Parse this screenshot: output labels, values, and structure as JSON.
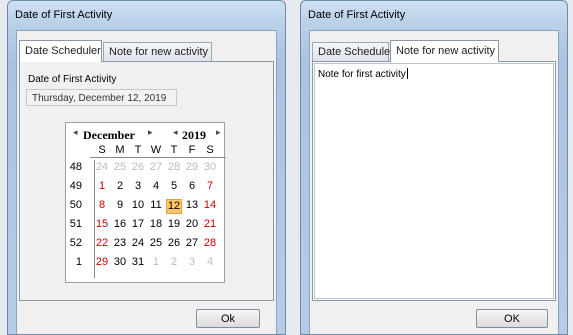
{
  "window1": {
    "title": "Date of First Activity",
    "tabs": [
      "Date Scheduler",
      "Note for new activity"
    ],
    "date_label": "Date of First Activity",
    "date_value": "Thursday, December 12, 2019",
    "ok_label": "Ok",
    "calendar": {
      "month": "December",
      "year": "2019",
      "day_headers": [
        "S",
        "M",
        "T",
        "W",
        "T",
        "F",
        "S"
      ],
      "weeks": [
        {
          "wk": "48",
          "days": [
            "24",
            "25",
            "26",
            "27",
            "28",
            "29",
            "30"
          ]
        },
        {
          "wk": "49",
          "days": [
            "1",
            "2",
            "3",
            "4",
            "5",
            "6",
            "7"
          ]
        },
        {
          "wk": "50",
          "days": [
            "8",
            "9",
            "10",
            "11",
            "12",
            "13",
            "14"
          ]
        },
        {
          "wk": "51",
          "days": [
            "15",
            "16",
            "17",
            "18",
            "19",
            "20",
            "21"
          ]
        },
        {
          "wk": "52",
          "days": [
            "22",
            "23",
            "24",
            "25",
            "26",
            "27",
            "28"
          ]
        },
        {
          "wk": "1",
          "days": [
            "29",
            "30",
            "31",
            "1",
            "2",
            "3",
            "4"
          ]
        }
      ],
      "selected_day": "12",
      "weekend_color": "#c00000",
      "other_month_color": "#bbbbbb",
      "highlight_color": "#f9c768"
    }
  },
  "window2": {
    "title": "Date of First Activity",
    "tabs": [
      "Date Scheduler",
      "Note for new activity"
    ],
    "note_text": "Note for first activity",
    "ok_label": "OK"
  }
}
